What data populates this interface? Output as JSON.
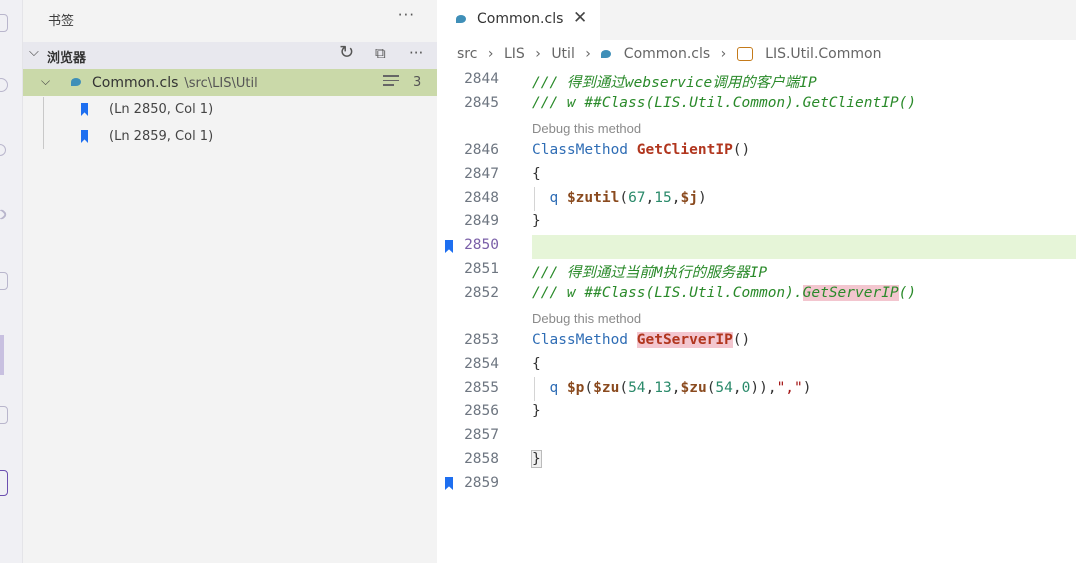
{
  "sidebar": {
    "title": "书签",
    "more_icon": "more-icon",
    "section": {
      "title": "浏览器",
      "refresh_icon": "refresh-icon",
      "collapse_icon": "collapse-all-icon",
      "more_icon": "more-icon"
    },
    "file": {
      "name": "Common.cls",
      "path": "\\src\\LIS\\Util",
      "count": "3",
      "bookmarks": [
        {
          "label": "(Ln 2850, Col 1)"
        },
        {
          "label": "(Ln 2859, Col 1)"
        }
      ]
    }
  },
  "editor": {
    "tab": {
      "label": "Common.cls",
      "close": "✕"
    },
    "breadcrumb": [
      "src",
      "LIS",
      "Util",
      "Common.cls",
      "LIS.Util.Common"
    ],
    "codelens": "Debug this method",
    "line_numbers": [
      "2844",
      "2845",
      "2846",
      "2847",
      "2848",
      "2849",
      "2850",
      "2851",
      "2852",
      "2853",
      "2854",
      "2855",
      "2856",
      "2857",
      "2858",
      "2859"
    ],
    "code": {
      "c2844": "/// 得到通过webservice调用的客户端IP",
      "c2845": "/// w ##Class(LIS.Util.Common).GetClientIP()",
      "kw_classmethod": "ClassMethod",
      "m_getclientip": "GetClientIP",
      "paren": "()",
      "open_brace": "{",
      "close_brace": "}",
      "q": "q",
      "zutil": "$zutil",
      "zutil_args_open": "(",
      "n67": "67",
      "comma": ",",
      "n15": "15",
      "jvar": "$j",
      "close_paren": ")",
      "c2851": "/// 得到通过当前M执行的服务器IP",
      "c2852_pre": "/// w ##Class(LIS.Util.Common).",
      "c2852_hl": "GetServerIP",
      "c2852_post": "()",
      "m_getserverip": "GetServerIP",
      "p": "$p",
      "zu": "$zu",
      "n54": "54",
      "n13": "13",
      "n0": "0",
      "str_comma": "\",\""
    }
  },
  "colors": {
    "bookmark": "#1e6ff0",
    "selection": "#cad9a9",
    "current_line": "#e6f5d8"
  }
}
